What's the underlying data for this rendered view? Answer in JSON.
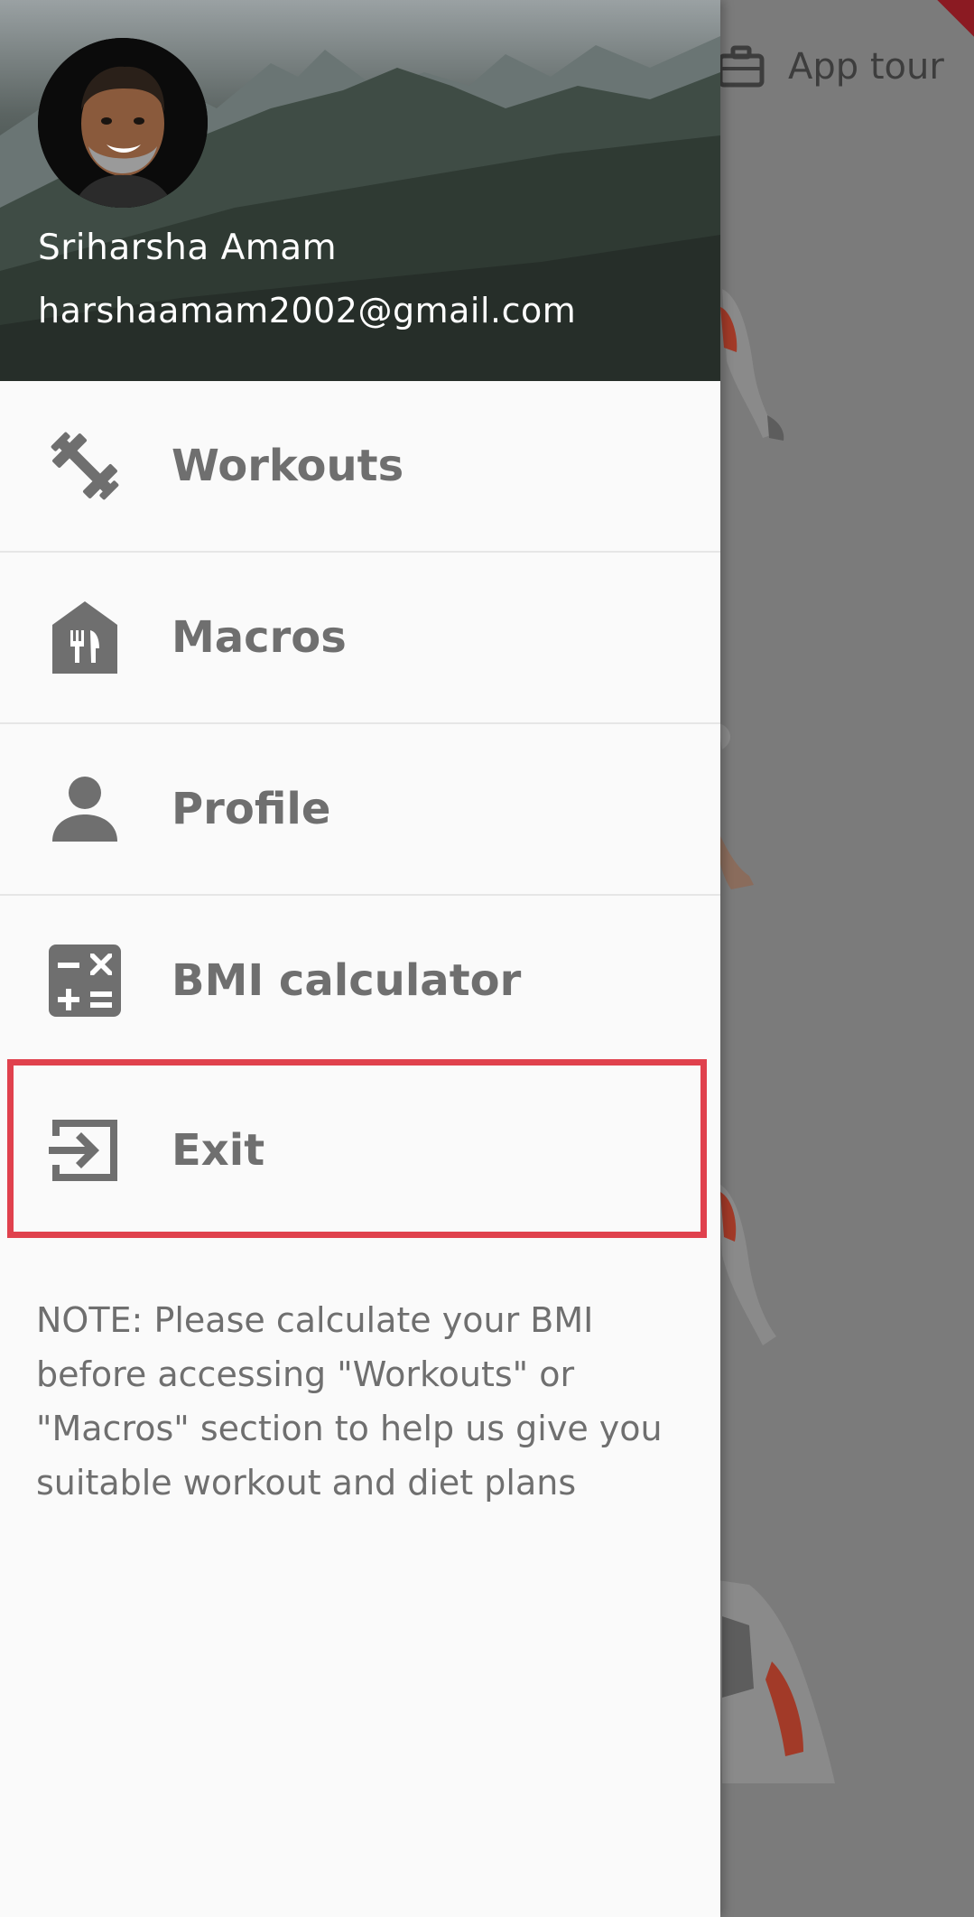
{
  "app_bar": {
    "app_tour_label": "App tour"
  },
  "drawer": {
    "user_name": "Sriharsha Amam",
    "user_email": "harshaamam2002@gmail.com",
    "menu": [
      {
        "label": "Workouts",
        "icon": "dumbbell-icon"
      },
      {
        "label": "Macros",
        "icon": "restaurant-icon"
      },
      {
        "label": "Profile",
        "icon": "person-icon"
      },
      {
        "label": "BMI calculator",
        "icon": "calculator-icon"
      },
      {
        "label": "Exit",
        "icon": "exit-icon"
      }
    ],
    "note": "NOTE: Please calculate your BMI before accessing \"Workouts\" or \"Macros\" section to help us give you suitable workout and diet plans"
  },
  "colors": {
    "highlight": "#e0414d",
    "menu_text": "#6f6f6f",
    "scrim": "#7b7b7b"
  }
}
